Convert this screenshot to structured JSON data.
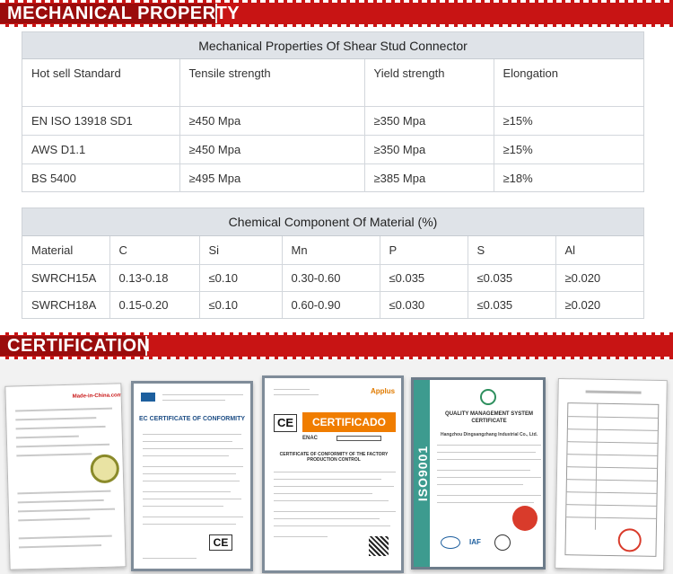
{
  "sections": {
    "mechanical_heading": "MECHANICAL PROPERTY",
    "certification_heading": "CERTIFICATION"
  },
  "mechanical_table": {
    "caption": "Mechanical Properties Of Shear Stud Connector",
    "headers": [
      "Hot sell Standard",
      "Tensile strength",
      "Yield strength",
      "Elongation"
    ],
    "rows": [
      [
        "EN ISO 13918 SD1",
        "≥450 Mpa",
        "≥350 Mpa",
        "≥15%"
      ],
      [
        "AWS D1.1",
        "≥450 Mpa",
        "≥350 Mpa",
        "≥15%"
      ],
      [
        "BS 5400",
        "≥495 Mpa",
        "≥385 Mpa",
        "≥18%"
      ]
    ]
  },
  "chemical_table": {
    "caption": "Chemical Component Of Material (%)",
    "headers": [
      "Material",
      "C",
      "Si",
      "Mn",
      "P",
      "S",
      "Al"
    ],
    "rows": [
      [
        "SWRCH15A",
        "0.13-0.18",
        "≤0.10",
        "0.30-0.60",
        "≤0.035",
        "≤0.035",
        "≥0.020"
      ],
      [
        "SWRCH18A",
        "0.15-0.20",
        "≤0.10",
        "0.60-0.90",
        "≤0.030",
        "≤0.035",
        "≥0.020"
      ]
    ]
  },
  "certificates": {
    "cert1_brand": "Made-in-China.com",
    "cert2_title": "EC CERTIFICATE OF CONFORMITY",
    "cert2_mark": "CE",
    "cert3_brand": "Applus",
    "cert3_mark": "CE",
    "cert3_label": "CERTIFICADO",
    "cert3_enac": "ENAC",
    "cert3_title": "CERTIFICATE OF CONFORMITY OF THE FACTORY PRODUCTION CONTROL",
    "cert4_side": "ISO9001",
    "cert4_title": "QUALITY MANAGEMENT SYSTEM CERTIFICATE",
    "cert4_company": "Hangzhou Dingsangzhang Industrial Co., Ltd.",
    "cert4_iaf": "IAF"
  },
  "colors": {
    "banner_red": "#c81414",
    "table_header_bg": "#dfe3e8",
    "cert_bg": "#f2f2f2"
  }
}
